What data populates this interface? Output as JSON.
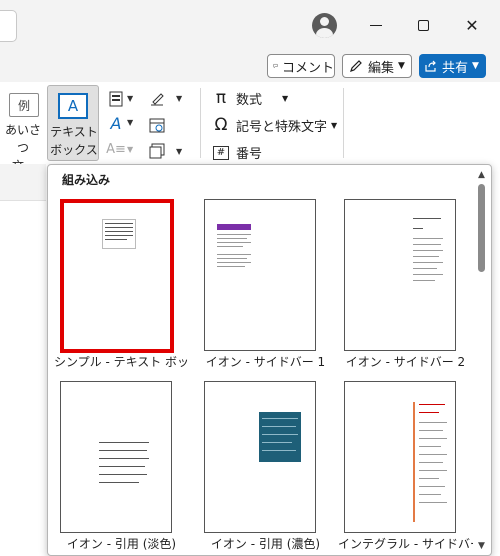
{
  "titlebar": {
    "avatar_icon": "person-icon",
    "minimize_icon": "minimize-icon",
    "maximize_icon": "maximize-icon",
    "close_icon": "close-icon",
    "close_glyph": "✕"
  },
  "actions": {
    "comment_label": "コメント",
    "edit_label": "編集",
    "share_label": "共有",
    "share_color": "#0f6cbd"
  },
  "ribbon": {
    "greeting_icon_text": "例",
    "greeting_label_line1": "あいさつ",
    "greeting_label_line2": "文",
    "textbox_icon_text": "A",
    "textbox_label_line1": "テキスト",
    "textbox_label_line2": "ボックス",
    "equation_label": "数式",
    "symbol_label": "記号と特殊文字",
    "number_label": "番号",
    "equation_glyph": "π",
    "symbol_glyph": "Ω",
    "number_glyph": "#"
  },
  "gallery": {
    "header": "組み込み",
    "selected_color": "#e00000",
    "items": [
      {
        "caption": "シンプル - テキスト ボッ…"
      },
      {
        "caption": "イオン - サイドバー 1"
      },
      {
        "caption": "イオン - サイドバー 2"
      },
      {
        "caption": "イオン - 引用 (淡色)"
      },
      {
        "caption": "イオン - 引用 (濃色)"
      },
      {
        "caption": "インテグラル - サイドバー"
      }
    ]
  }
}
